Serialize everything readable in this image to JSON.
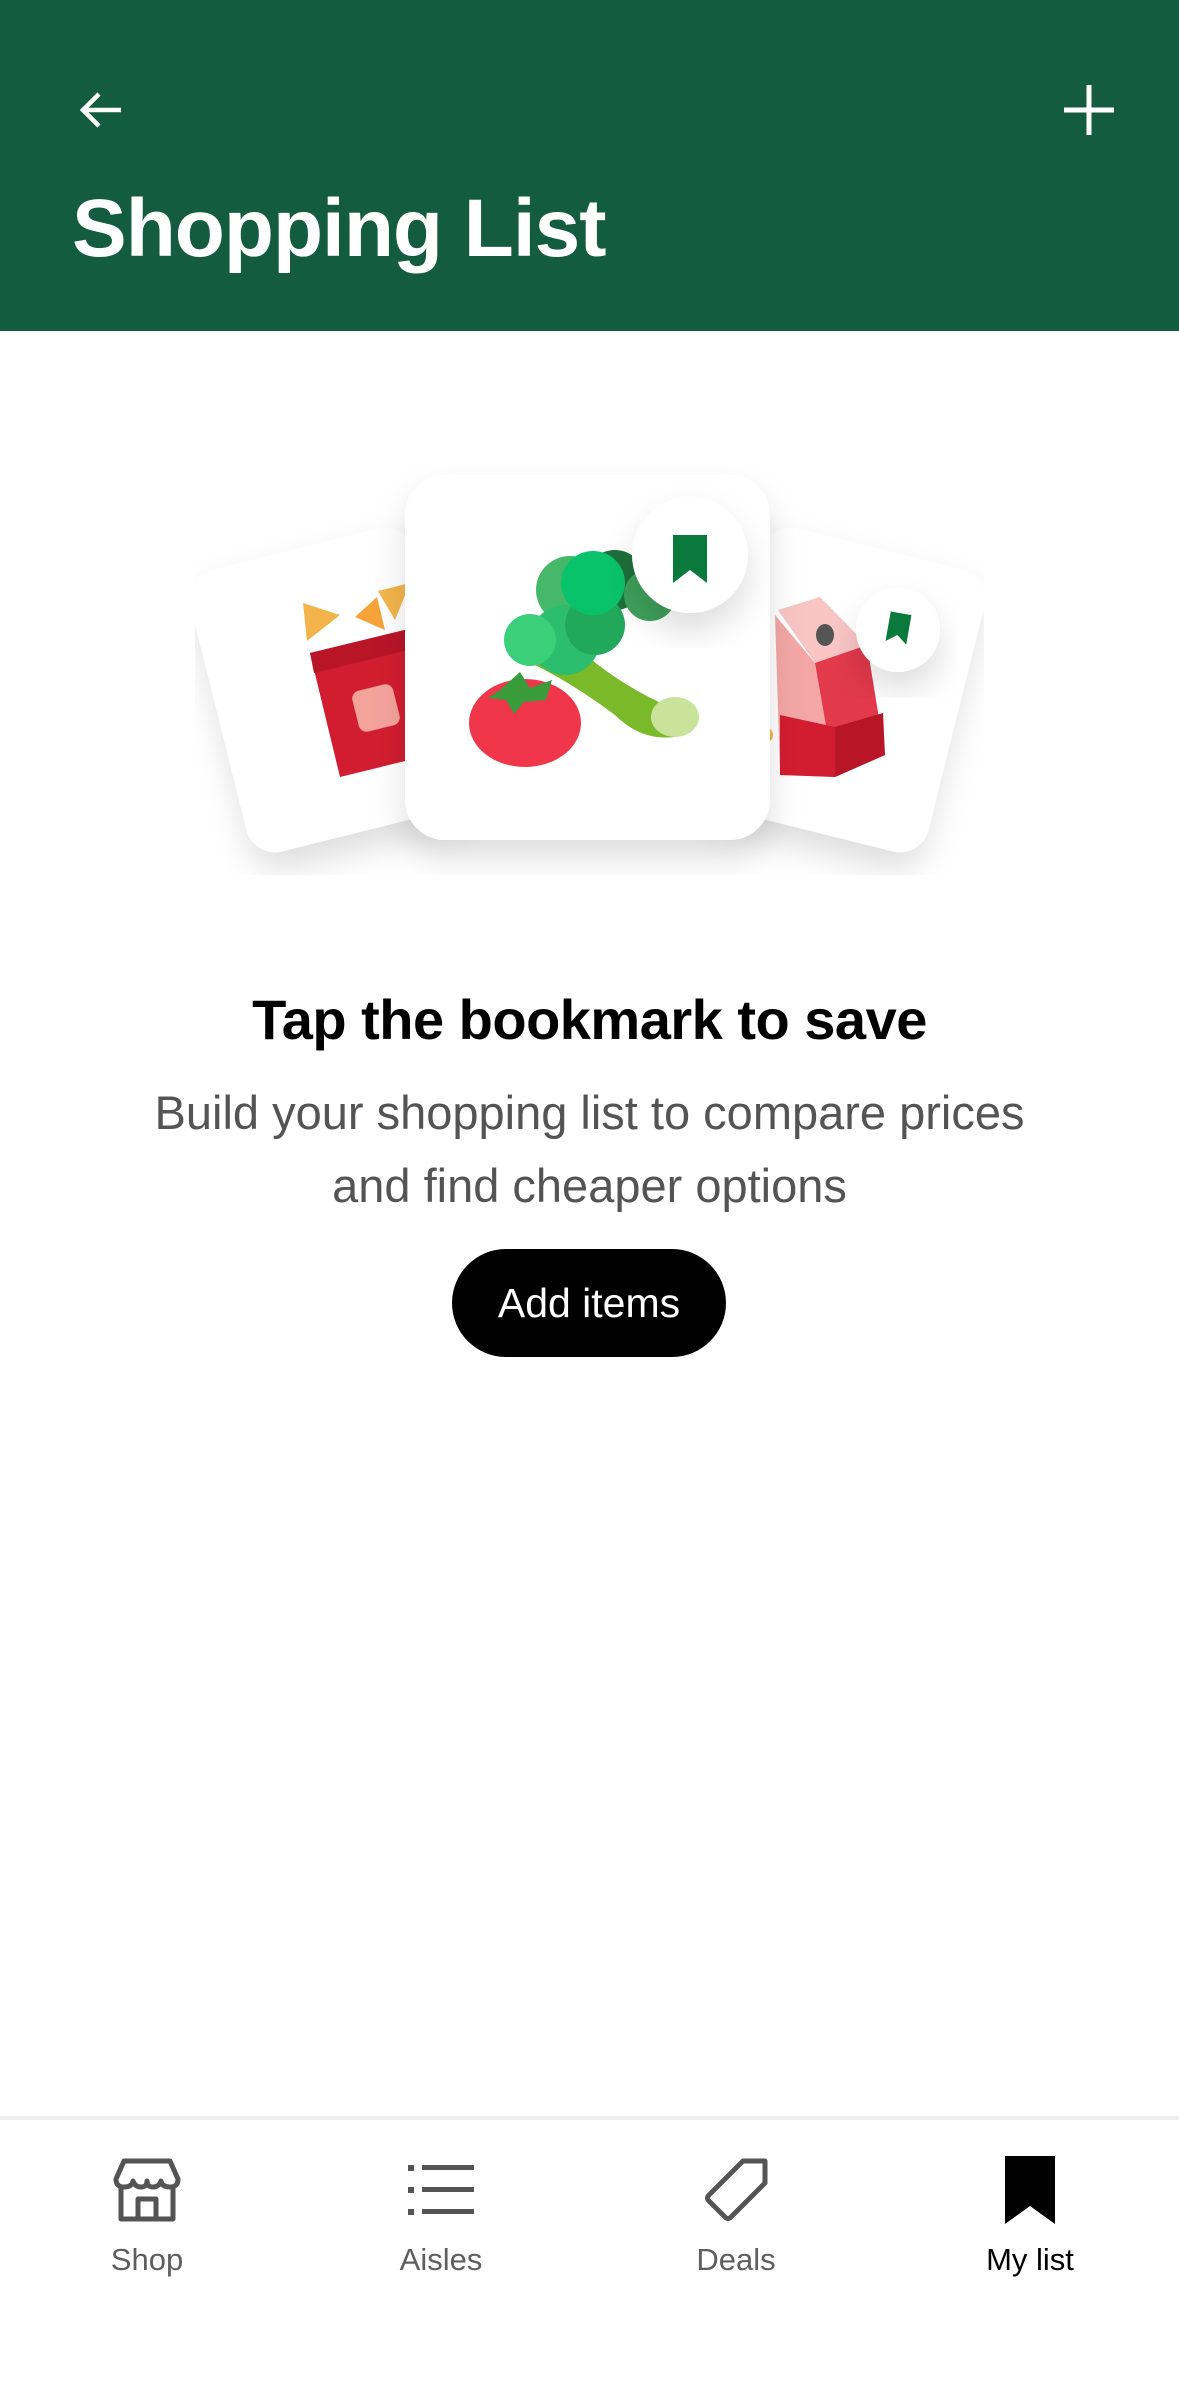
{
  "header": {
    "title": "Shopping List",
    "back_icon": "arrow-left-icon",
    "add_icon": "plus-icon",
    "background": "#145c41"
  },
  "empty_state": {
    "title": "Tap the bookmark to save",
    "description": "Build your shopping list to compare prices and find cheaper options",
    "button_label": "Add items"
  },
  "bottom_nav": {
    "items": [
      {
        "label": "Shop",
        "icon": "store-icon",
        "active": false
      },
      {
        "label": "Aisles",
        "icon": "list-icon",
        "active": false
      },
      {
        "label": "Deals",
        "icon": "tag-icon",
        "active": false
      },
      {
        "label": "My list",
        "icon": "bookmark-icon",
        "active": true
      }
    ]
  },
  "colors": {
    "brand_green": "#145c41",
    "bookmark_green": "#0a7a3c",
    "button_black": "#000000",
    "secondary_text": "#545454"
  }
}
